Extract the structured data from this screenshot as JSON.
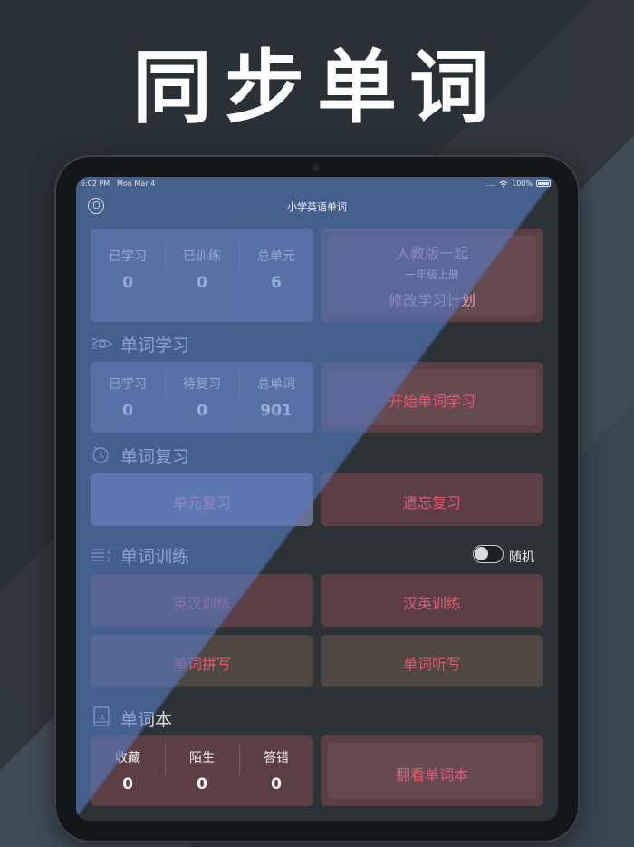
{
  "hero": {
    "title": "同步单词"
  },
  "status_bar": {
    "time": "6:02 PM",
    "date": "Mon Mar 4",
    "signal": "....",
    "battery": "100%"
  },
  "navbar": {
    "title": "小学英语单词"
  },
  "overview": {
    "stats": [
      {
        "label": "已学习",
        "value": "0"
      },
      {
        "label": "已训练",
        "value": "0"
      },
      {
        "label": "总单元",
        "value": "6"
      }
    ],
    "plan": {
      "edition": "人教版一起",
      "grade": "一年级上册",
      "action": "修改学习计划"
    }
  },
  "word_study": {
    "title": "单词学习",
    "stats": [
      {
        "label": "已学习",
        "value": "0"
      },
      {
        "label": "待复习",
        "value": "0"
      },
      {
        "label": "总单词",
        "value": "901"
      }
    ],
    "start_label": "开始单词学习"
  },
  "word_review": {
    "title": "单词复习",
    "unit_review": "单元复习",
    "forget_review": "遗忘复习"
  },
  "word_training": {
    "title": "单词训练",
    "random_label": "随机",
    "random_on": false,
    "en_cn": "英汉训练",
    "cn_en": "汉英训练",
    "spelling": "单词拼写",
    "dictation": "单词听写"
  },
  "word_book": {
    "title": "单词本",
    "stats": [
      {
        "label": "收藏",
        "value": "0"
      },
      {
        "label": "陌生",
        "value": "0"
      },
      {
        "label": "答错",
        "value": "0"
      }
    ],
    "open_label": "翻看单词本"
  }
}
